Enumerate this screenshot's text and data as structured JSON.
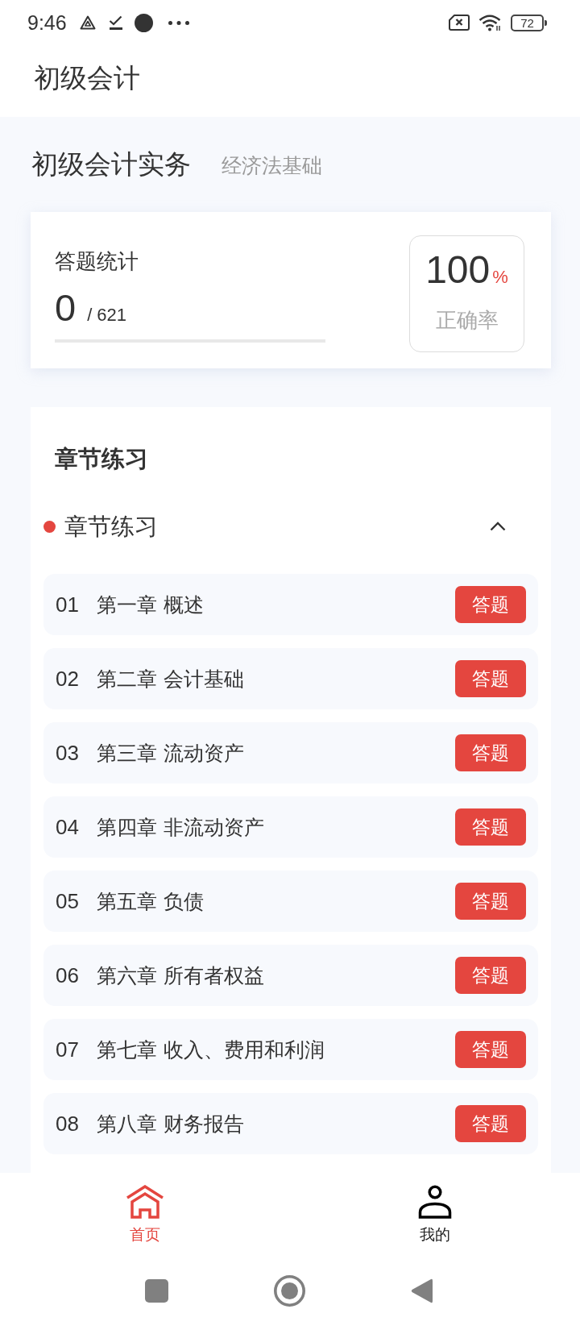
{
  "status_bar": {
    "time": "9:46",
    "battery": "72"
  },
  "header": {
    "title": "初级会计"
  },
  "subject_tabs": [
    {
      "label": "初级会计实务",
      "selected": true
    },
    {
      "label": "经济法基础",
      "selected": false
    }
  ],
  "stats": {
    "title": "答题统计",
    "answered": "0",
    "total": "/ 621",
    "level": 0,
    "accuracy": {
      "value": "100",
      "unit": "%",
      "label": "正确率"
    }
  },
  "practice": {
    "title": "章节练习",
    "section": {
      "label": "章节练习",
      "expanded": true
    },
    "chapters": [
      {
        "number": "01",
        "title": "第一章 概述",
        "button": "答题"
      },
      {
        "number": "02",
        "title": "第二章 会计基础",
        "button": "答题"
      },
      {
        "number": "03",
        "title": "第三章 流动资产",
        "button": "答题"
      },
      {
        "number": "04",
        "title": "第四章 非流动资产",
        "button": "答题"
      },
      {
        "number": "05",
        "title": "第五章 负债",
        "button": "答题"
      },
      {
        "number": "06",
        "title": "第六章 所有者权益",
        "button": "答题"
      },
      {
        "number": "07",
        "title": "第七章 收入、费用和利润",
        "button": "答题"
      },
      {
        "number": "08",
        "title": "第八章 财务报告",
        "button": "答题"
      }
    ]
  },
  "bottom_nav": [
    {
      "kind": "home",
      "label": "首页",
      "selected": true
    },
    {
      "kind": "profile",
      "label": "我的",
      "selected": false
    }
  ]
}
